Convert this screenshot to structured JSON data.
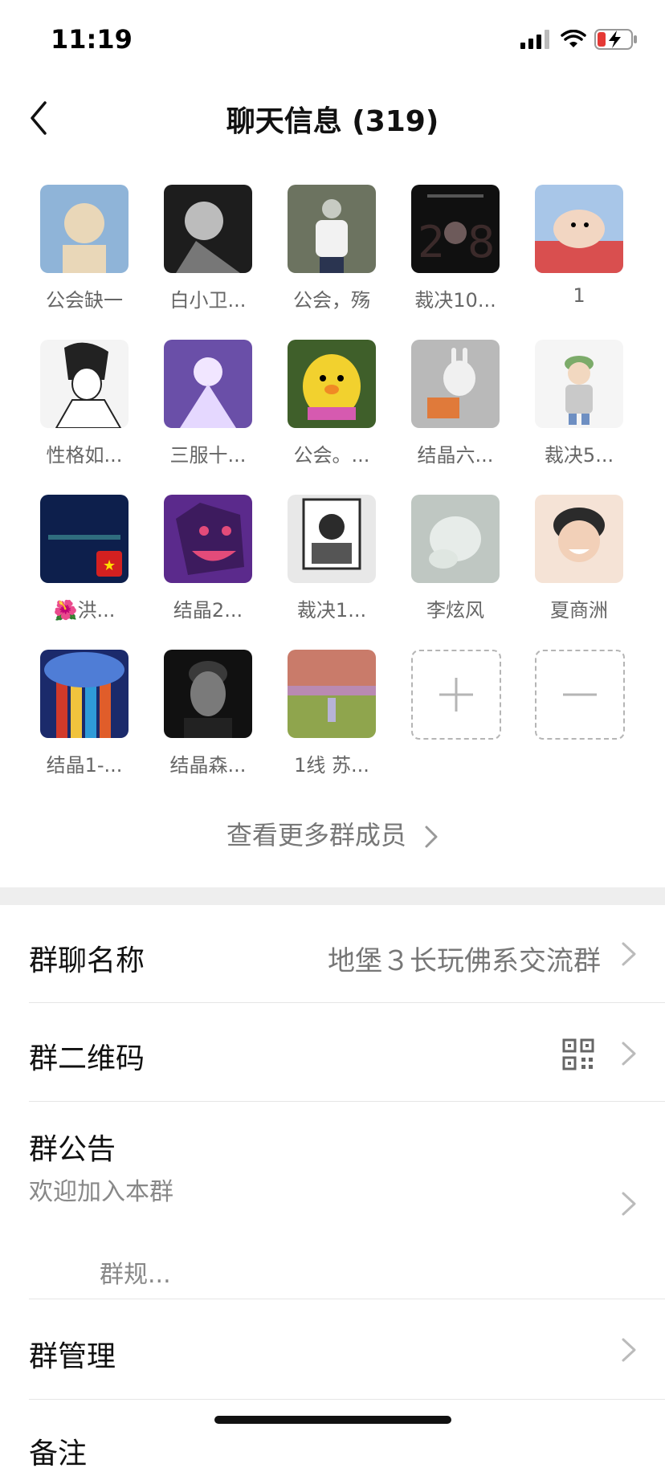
{
  "status": {
    "time": "11:19"
  },
  "header": {
    "title": "聊天信息 (319)"
  },
  "members": [
    {
      "name": "公会缺一",
      "colors": [
        "#8fb4d8",
        "#e9d7b8"
      ]
    },
    {
      "name": "白小卫...",
      "colors": [
        "#1d1d1d",
        "#bcbcbc"
      ]
    },
    {
      "name": "公会，殇",
      "colors": [
        "#6c7360",
        "#c7cbc3"
      ]
    },
    {
      "name": "裁决10...",
      "colors": [
        "#101010",
        "#6d5a5a"
      ]
    },
    {
      "name": "1",
      "colors": [
        "#d94f4f",
        "#f2d6c2"
      ]
    },
    {
      "name": "性格如...",
      "colors": [
        "#f4f4f4",
        "#222222"
      ]
    },
    {
      "name": "三服十...",
      "colors": [
        "#6a4fa8",
        "#f1e6ff"
      ]
    },
    {
      "name": "公会。...",
      "colors": [
        "#f2d12e",
        "#3f5f2a"
      ]
    },
    {
      "name": "结晶六...",
      "colors": [
        "#b9b9b9",
        "#f0f0f0"
      ]
    },
    {
      "name": "裁决5...",
      "colors": [
        "#f5f5f5",
        "#7cab6a"
      ]
    },
    {
      "name": "🌺洪...",
      "colors": [
        "#0d1f4c",
        "#2f6d7e"
      ]
    },
    {
      "name": "结晶2...",
      "colors": [
        "#5b2a8c",
        "#e34b7a"
      ]
    },
    {
      "name": "裁决1...",
      "colors": [
        "#2b2b2b",
        "#e8e8e8"
      ]
    },
    {
      "name": "李炫风",
      "colors": [
        "#bfc7c2",
        "#e7ece9"
      ]
    },
    {
      "name": "夏商洲",
      "colors": [
        "#d9b39a",
        "#f5e3d6"
      ]
    },
    {
      "name": "结晶1-...",
      "colors": [
        "#d23a2a",
        "#f1c33d"
      ]
    },
    {
      "name": "结晶森...",
      "colors": [
        "#111111",
        "#7a7a7a"
      ]
    },
    {
      "name": "1线 苏...",
      "colors": [
        "#c97b6a",
        "#8fa54d"
      ]
    }
  ],
  "actions": {
    "add": "+",
    "remove": "—"
  },
  "more_members": "查看更多群成员",
  "settings": {
    "group_name": {
      "label": "群聊名称",
      "value": "地堡３长玩佛系交流群"
    },
    "qr_code": {
      "label": "群二维码"
    },
    "announcement": {
      "label": "群公告",
      "line1": "欢迎加入本群",
      "line2": "群规..."
    },
    "manage": {
      "label": "群管理"
    },
    "remark": {
      "label": "备注"
    }
  }
}
